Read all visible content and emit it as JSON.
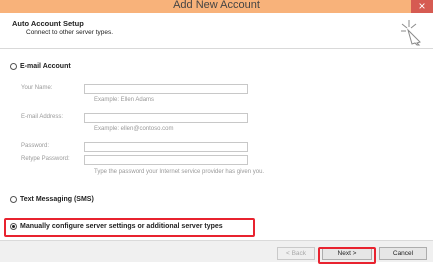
{
  "window": {
    "title": "Add New Account",
    "close_symbol": "×",
    "titlebar_color": "#f8b27a"
  },
  "header": {
    "title": "Auto Account Setup",
    "subtitle": "Connect to other server types.",
    "icon": "wizard-sparkle-icon"
  },
  "options": {
    "email_account": {
      "label": "E-mail Account",
      "checked": false
    },
    "text_messaging": {
      "label": "Text Messaging (SMS)",
      "checked": false
    },
    "manual": {
      "label": "Manually configure server settings or additional server types",
      "checked": true
    }
  },
  "email_fields": {
    "name": {
      "label": "Your Name:",
      "value": "",
      "hint": "Example: Ellen Adams"
    },
    "email": {
      "label": "E-mail Address:",
      "value": "",
      "hint": "Example: ellen@contoso.com"
    },
    "password": {
      "label": "Password:",
      "value": ""
    },
    "retype_password": {
      "label": "Retype Password:",
      "value": ""
    },
    "password_hint": "Type the password your Internet service provider has given you."
  },
  "footer": {
    "back_label": "< Back",
    "next_label": "Next >",
    "cancel_label": "Cancel"
  },
  "highlight_color": "#e8232f"
}
